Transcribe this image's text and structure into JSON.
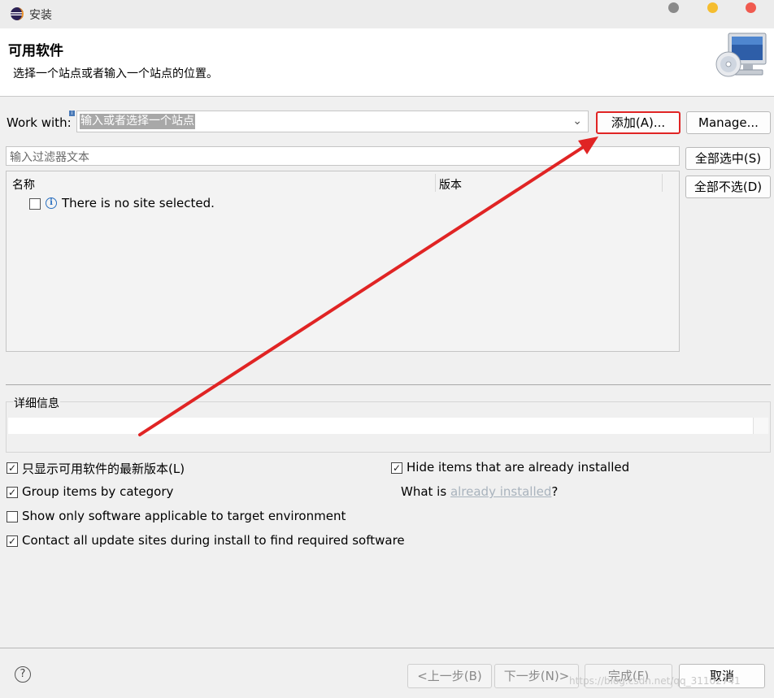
{
  "window": {
    "title": "安装",
    "app_icon": "eclipse-icon"
  },
  "header": {
    "title": "可用软件",
    "description": "选择一个站点或者输入一个站点的位置。",
    "icon": "monitor-cd-icon"
  },
  "work_with": {
    "label": "Work with:",
    "value": "输入或者选择一个站点",
    "add_button": "添加(A)...",
    "manage_button": "Manage..."
  },
  "filter": {
    "placeholder": "输入过滤器文本"
  },
  "side_buttons": {
    "select_all": "全部选中(S)",
    "deselect_all": "全部不选(D)"
  },
  "table": {
    "columns": [
      "名称",
      "版本"
    ],
    "rows": [
      {
        "checked": false,
        "icon": "info-icon",
        "text": "There is no site selected."
      }
    ]
  },
  "details": {
    "label": "详细信息",
    "value": ""
  },
  "options": {
    "latest_only": {
      "label": "只显示可用软件的最新版本(L)",
      "checked": true
    },
    "group_by_category": {
      "label": "Group items by category",
      "checked": true
    },
    "target_env_only": {
      "label": "Show only software applicable to target environment",
      "checked": false
    },
    "contact_all_sites": {
      "label": "Contact all update sites during install to find required software",
      "checked": true
    },
    "hide_installed": {
      "label": "Hide items that are already installed",
      "checked": true
    },
    "what_is_prefix": "What is ",
    "what_is_link": "already installed",
    "what_is_suffix": "?"
  },
  "footer": {
    "back": "<上一步(B)",
    "next": "下一步(N)>",
    "finish": "完成(F)",
    "cancel": "取消",
    "help_icon": "help-icon"
  },
  "watermark": "https://blog.csdn.net/qq_31102741",
  "colors": {
    "annotation": "#e02424",
    "link": "#a9b3bd",
    "selection": "#a8a8a8"
  }
}
